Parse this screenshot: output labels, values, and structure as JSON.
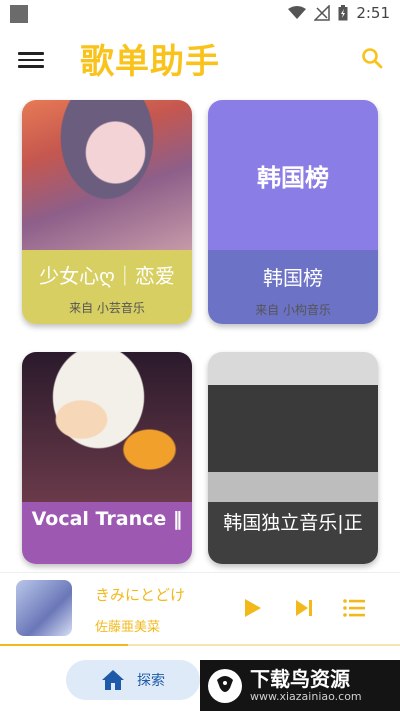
{
  "status_bar": {
    "time": "2:51"
  },
  "app_bar": {
    "title": "歌单助手",
    "menu_icon": "menu-icon",
    "search_icon": "search-icon"
  },
  "colors": {
    "accent": "#f9c31c",
    "nav_pill": "#deeaf7",
    "nav_text": "#1e5aa8"
  },
  "playlists": [
    {
      "name": "少女心ღ｜恋爱",
      "source": "来自 小芸音乐",
      "color": "#d7cf62"
    },
    {
      "name": "韩国榜",
      "art_label": "韩国榜",
      "source": "来自 小构音乐",
      "color": "#6c72c5"
    },
    {
      "name": "Vocal Trance ‖",
      "color": "#9d58b2"
    },
    {
      "name": "韩国独立音乐|正",
      "color": "#3f3f3f"
    }
  ],
  "player": {
    "song_title": "きみにとどけ",
    "artist": "佐藤亜美菜",
    "progress": 0.32
  },
  "bottom_nav": {
    "label": "探索",
    "icon": "home-icon"
  },
  "watermark": {
    "title": "下载鸟资源",
    "url": "www.xiazainiao.com"
  }
}
